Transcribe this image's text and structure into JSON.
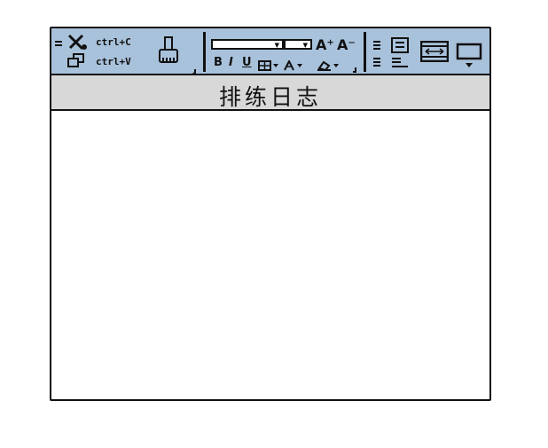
{
  "window": {
    "title": "排练日志"
  },
  "clipboard": {
    "copy_shortcut": "ctrl+C",
    "paste_shortcut": "ctrl+V",
    "icons": [
      "cut-icon",
      "copy-icon",
      "format-painter-icon"
    ]
  },
  "font": {
    "grow_label": "A⁺",
    "shrink_label": "A⁻",
    "bold_label": "B",
    "italic_label": "I",
    "underline_label": "U"
  },
  "colors": {
    "ribbon": "#a9c2db",
    "title_bar": "#d8d8d8",
    "outline": "#111111"
  }
}
